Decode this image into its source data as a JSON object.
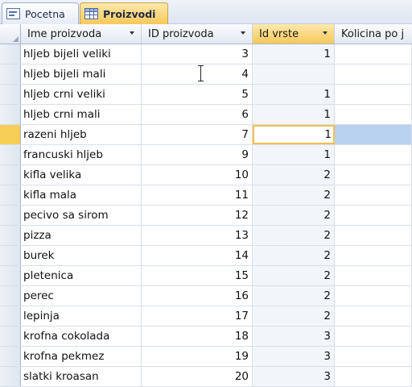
{
  "tabs": [
    {
      "label": "Pocetna",
      "icon": "form-icon",
      "active": false
    },
    {
      "label": "Proizvodi",
      "icon": "table-icon",
      "active": true
    }
  ],
  "columns": [
    "Ime proizvoda",
    "ID proizvoda",
    "Id vrste",
    "Kolicina po j"
  ],
  "active_column": "Id vrste",
  "rows": [
    {
      "name": "hljeb bijeli veliki",
      "id": "3",
      "vrsta": "1"
    },
    {
      "name": "hljeb bijeli mali",
      "id": "4",
      "vrsta": ""
    },
    {
      "name": "hljeb crni veliki",
      "id": "5",
      "vrsta": "1"
    },
    {
      "name": "hljeb crni mali",
      "id": "6",
      "vrsta": "1"
    },
    {
      "name": "razeni hljeb",
      "id": "7",
      "vrsta": "1"
    },
    {
      "name": "francuski hljeb",
      "id": "9",
      "vrsta": "1"
    },
    {
      "name": "kifla velika",
      "id": "10",
      "vrsta": "2"
    },
    {
      "name": "kifla mala",
      "id": "11",
      "vrsta": "2"
    },
    {
      "name": "pecivo sa sirom",
      "id": "12",
      "vrsta": "2"
    },
    {
      "name": "pizza",
      "id": "13",
      "vrsta": "2"
    },
    {
      "name": "burek",
      "id": "14",
      "vrsta": "2"
    },
    {
      "name": "pletenica",
      "id": "15",
      "vrsta": "2"
    },
    {
      "name": "perec",
      "id": "16",
      "vrsta": "2"
    },
    {
      "name": "lepinja",
      "id": "17",
      "vrsta": "2"
    },
    {
      "name": "krofna cokolada",
      "id": "18",
      "vrsta": "3"
    },
    {
      "name": "krofna pekmez",
      "id": "19",
      "vrsta": "3"
    },
    {
      "name": "slatki kroasan",
      "id": "20",
      "vrsta": "3"
    }
  ],
  "current_row": 4,
  "colors": {
    "active_tab": "#f7c85a",
    "selection": "#b9d2f0",
    "current_cell_border": "#f1c14b"
  }
}
